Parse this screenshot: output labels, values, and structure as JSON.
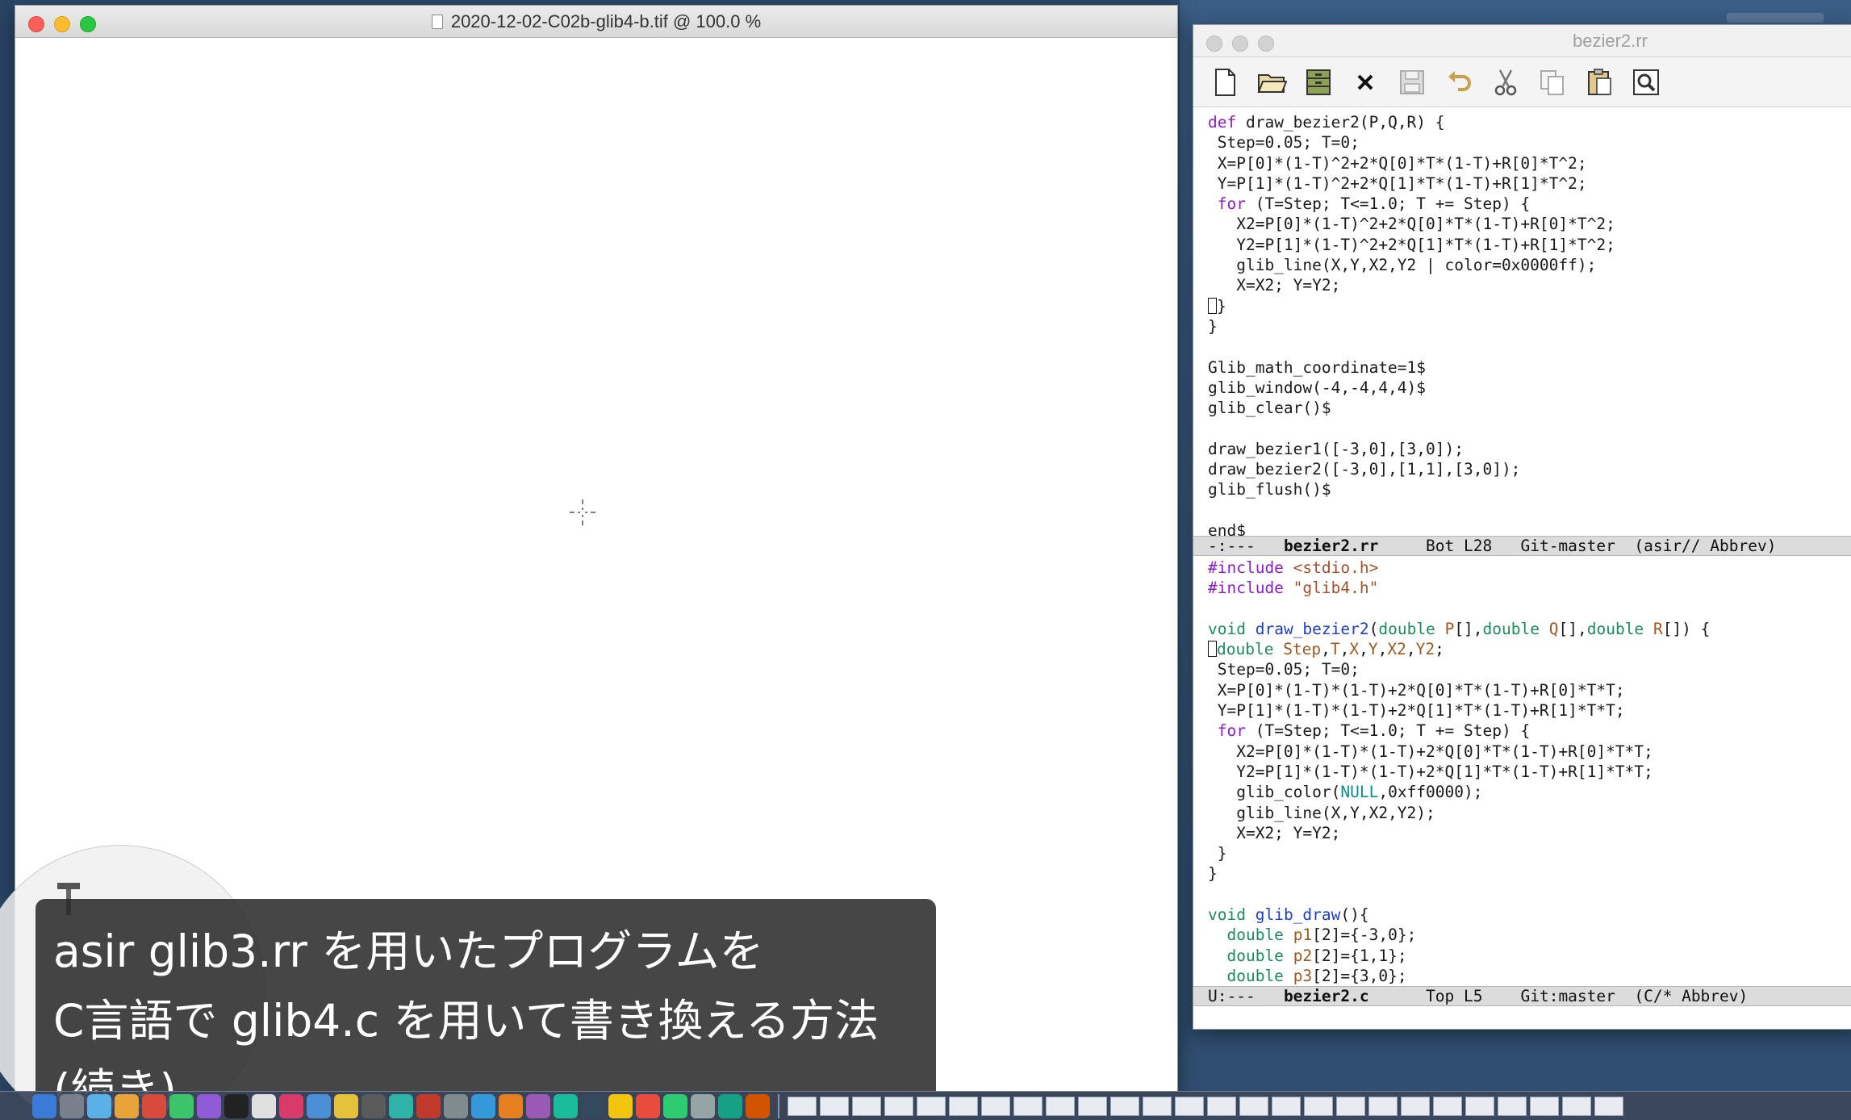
{
  "viewer": {
    "title": "2020-12-02-C02b-glib4-b.tif @ 100.0 %"
  },
  "emacs": {
    "title": "bezier2.rr",
    "toolbar": [
      {
        "name": "new-file-icon"
      },
      {
        "name": "open-folder-icon"
      },
      {
        "name": "dired-cabinet-icon"
      },
      {
        "name": "close-buffer-icon"
      },
      {
        "name": "save-icon"
      },
      {
        "name": "undo-icon"
      },
      {
        "name": "cut-icon"
      },
      {
        "name": "copy-icon"
      },
      {
        "name": "paste-icon"
      },
      {
        "name": "search-icon"
      }
    ],
    "modeline_top": {
      "status": "-:---",
      "buffer": "bezier2.rr",
      "position": "Bot L28",
      "vc": "Git-master",
      "mode": "(asir// Abbrev)"
    },
    "modeline_bottom": {
      "status": "U:---",
      "buffer": "bezier2.c",
      "position": "Top L5",
      "vc": "Git:master",
      "mode": "(C/* Abbrev)"
    }
  },
  "subtitle": {
    "line1": "asir  glib3.rr を用いたプログラムを",
    "line2": "C言語で glib4.c を用いて書き換える方法",
    "line3": "(続き)"
  },
  "colors": {
    "keyword": "#8b1ec4",
    "function": "#1f3fbd",
    "type": "#1f8a5c",
    "variable": "#9b5a21",
    "string": "#a0522d",
    "constant": "#0b8b8b"
  },
  "code_top": [
    [
      {
        "t": "def",
        "c": "kw"
      },
      {
        "t": " draw_bezier2(P,Q,R) {"
      }
    ],
    [
      {
        "t": " Step=0.05; T=0;"
      }
    ],
    [
      {
        "t": " X=P[0]*(1-T)^2+2*Q[0]*T*(1-T)+R[0]*T^2;"
      }
    ],
    [
      {
        "t": " Y=P[1]*(1-T)^2+2*Q[1]*T*(1-T)+R[1]*T^2;"
      }
    ],
    [
      {
        "t": " "
      },
      {
        "t": "for",
        "c": "kw"
      },
      {
        "t": " (T=Step; T<=1.0; T += Step) {"
      }
    ],
    [
      {
        "t": "   X2=P[0]*(1-T)^2+2*Q[0]*T*(1-T)+R[0]*T^2;"
      }
    ],
    [
      {
        "t": "   Y2=P[1]*(1-T)^2+2*Q[1]*T*(1-T)+R[1]*T^2;"
      }
    ],
    [
      {
        "t": "   glib_line(X,Y,X2,Y2 | color=0x0000ff);"
      }
    ],
    [
      {
        "t": "   X=X2; Y=Y2;"
      }
    ],
    [
      {
        "t": "",
        "cursor": true
      },
      {
        "t": "}"
      }
    ],
    [
      {
        "t": "}"
      }
    ],
    [
      {
        "t": ""
      }
    ],
    [
      {
        "t": "Glib_math_coordinate=1$"
      }
    ],
    [
      {
        "t": "glib_window(-4,-4,4,4)$"
      }
    ],
    [
      {
        "t": "glib_clear()$"
      }
    ],
    [
      {
        "t": ""
      }
    ],
    [
      {
        "t": "draw_bezier1([-3,0],[3,0]);"
      }
    ],
    [
      {
        "t": "draw_bezier2([-3,0],[1,1],[3,0]);"
      }
    ],
    [
      {
        "t": "glib_flush()$"
      }
    ],
    [
      {
        "t": ""
      }
    ],
    [
      {
        "t": "end$"
      }
    ]
  ],
  "code_bottom": [
    [
      {
        "t": "#include",
        "c": "pp"
      },
      {
        "t": " "
      },
      {
        "t": "<stdio.h>",
        "c": "str"
      }
    ],
    [
      {
        "t": "#include",
        "c": "pp"
      },
      {
        "t": " "
      },
      {
        "t": "\"glib4.h\"",
        "c": "str"
      }
    ],
    [
      {
        "t": ""
      }
    ],
    [
      {
        "t": "void",
        "c": "ty"
      },
      {
        "t": " "
      },
      {
        "t": "draw_bezier2",
        "c": "fn"
      },
      {
        "t": "("
      },
      {
        "t": "double",
        "c": "ty"
      },
      {
        "t": " "
      },
      {
        "t": "P",
        "c": "var"
      },
      {
        "t": "[],"
      },
      {
        "t": "double",
        "c": "ty"
      },
      {
        "t": " "
      },
      {
        "t": "Q",
        "c": "var"
      },
      {
        "t": "[],"
      },
      {
        "t": "double",
        "c": "ty"
      },
      {
        "t": " "
      },
      {
        "t": "R",
        "c": "var"
      },
      {
        "t": "[]) {"
      }
    ],
    [
      {
        "t": "",
        "cursor": true
      },
      {
        "t": "double",
        "c": "ty"
      },
      {
        "t": " "
      },
      {
        "t": "Step",
        "c": "var"
      },
      {
        "t": ","
      },
      {
        "t": "T",
        "c": "var"
      },
      {
        "t": ","
      },
      {
        "t": "X",
        "c": "var"
      },
      {
        "t": ","
      },
      {
        "t": "Y",
        "c": "var"
      },
      {
        "t": ","
      },
      {
        "t": "X2",
        "c": "var"
      },
      {
        "t": ","
      },
      {
        "t": "Y2",
        "c": "var"
      },
      {
        "t": ";"
      }
    ],
    [
      {
        "t": " Step=0.05; T=0;"
      }
    ],
    [
      {
        "t": " X=P[0]*(1-T)*(1-T)+2*Q[0]*T*(1-T)+R[0]*T*T;"
      }
    ],
    [
      {
        "t": " Y=P[1]*(1-T)*(1-T)+2*Q[1]*T*(1-T)+R[1]*T*T;"
      }
    ],
    [
      {
        "t": " "
      },
      {
        "t": "for",
        "c": "kw"
      },
      {
        "t": " (T=Step; T<=1.0; T += Step) {"
      }
    ],
    [
      {
        "t": "   X2=P[0]*(1-T)*(1-T)+2*Q[0]*T*(1-T)+R[0]*T*T;"
      }
    ],
    [
      {
        "t": "   Y2=P[1]*(1-T)*(1-T)+2*Q[1]*T*(1-T)+R[1]*T*T;"
      }
    ],
    [
      {
        "t": "   glib_color("
      },
      {
        "t": "NULL",
        "c": "cst"
      },
      {
        "t": ",0xff0000);"
      }
    ],
    [
      {
        "t": "   glib_line(X,Y,X2,Y2);"
      }
    ],
    [
      {
        "t": "   X=X2; Y=Y2;"
      }
    ],
    [
      {
        "t": " }"
      }
    ],
    [
      {
        "t": "}"
      }
    ],
    [
      {
        "t": ""
      }
    ],
    [
      {
        "t": "void",
        "c": "ty"
      },
      {
        "t": " "
      },
      {
        "t": "glib_draw",
        "c": "fn"
      },
      {
        "t": "(){"
      }
    ],
    [
      {
        "t": "  "
      },
      {
        "t": "double",
        "c": "ty"
      },
      {
        "t": " "
      },
      {
        "t": "p1",
        "c": "var"
      },
      {
        "t": "[2]={-3,0};"
      }
    ],
    [
      {
        "t": "  "
      },
      {
        "t": "double",
        "c": "ty"
      },
      {
        "t": " "
      },
      {
        "t": "p2",
        "c": "var"
      },
      {
        "t": "[2]={1,1};"
      }
    ],
    [
      {
        "t": "  "
      },
      {
        "t": "double",
        "c": "ty"
      },
      {
        "t": " "
      },
      {
        "t": "p3",
        "c": "var"
      },
      {
        "t": "[2]={3,0};"
      }
    ]
  ]
}
